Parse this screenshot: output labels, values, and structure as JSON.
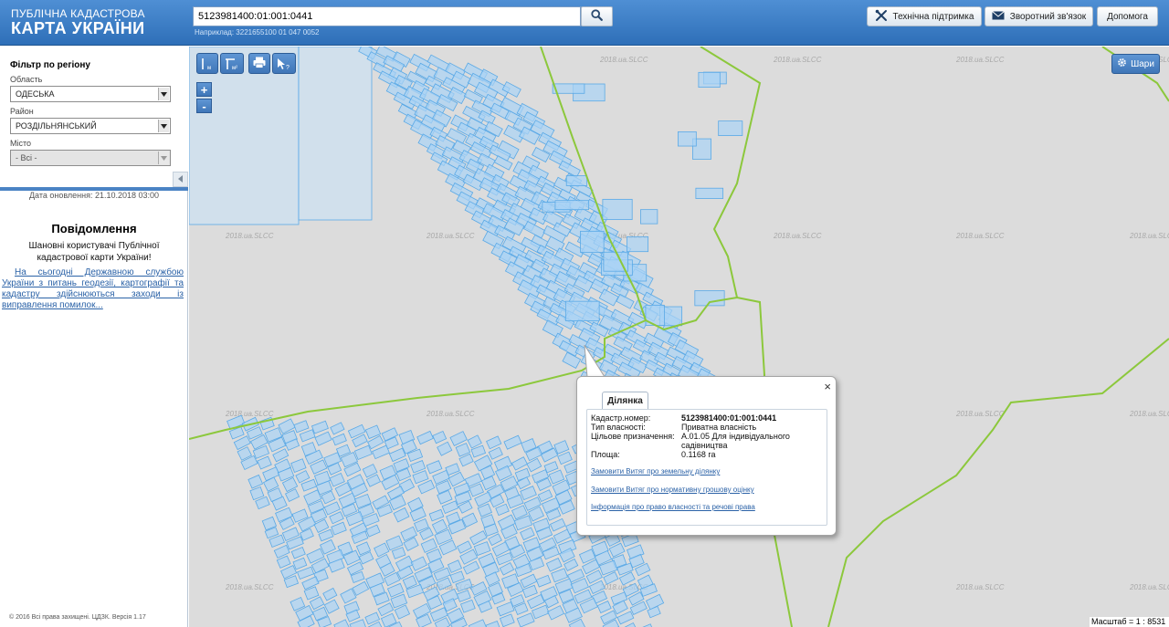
{
  "header": {
    "logo_line1": "ПУБЛІЧНА КАДАСТРОВА",
    "logo_line2": "КАРТА УКРАЇНИ",
    "search_value": "5123981400:01:001:0441",
    "search_example": "Наприклад: 3221655100 01 047 0052",
    "support_label": "Технічна підтримка",
    "feedback_label": "Зворотний зв'язок",
    "help_label": "Допомога"
  },
  "sidebar": {
    "filter_title": "Фільтр по регіону",
    "region_label": "Область",
    "region_value": "ОДЕСЬКА",
    "district_label": "Район",
    "district_value": "РОЗДІЛЬНЯНСЬКИЙ",
    "city_label": "Місто",
    "city_value": "- Всі -",
    "update_date": "Дата оновлення: 21.10.2018 03:00",
    "news_title": "Повідомлення",
    "news_text": "Шановні користувачі Публічної кадастрової карти України!",
    "news_link": "На сьогодні Державною службою України з питань геодезії, картографії та кадастру здійснюються заходи із виправлення помилок...",
    "copyright": "© 2016 Всі права захищені. ЦДЗК. Версія 1.17"
  },
  "map": {
    "watermark": "2018.ua.SLCC",
    "layers_label": "Шари",
    "zoom_in": "+",
    "zoom_out": "-",
    "tool_m": "м",
    "tool_m2": "м²",
    "tool_query": "?",
    "scale_text": "Масштаб = 1 : 8531"
  },
  "popup": {
    "tab_label": "Ділянка",
    "close_symbol": "×",
    "rows": [
      {
        "key": "Кадастр.номер:",
        "value": "5123981400:01:001:0441"
      },
      {
        "key": "Тип власності:",
        "value": "Приватна власність"
      },
      {
        "key": "Цільове призначення:",
        "value": "А.01.05 Для індивідуального садівництва"
      },
      {
        "key": "Площа:",
        "value": "0.1168 га"
      }
    ],
    "link1": "Замовити Витяг про земельну ділянку",
    "link2": "Замовити Витяг про нормативну грошову оцінку",
    "link3": "Інформація про право власності та речові права"
  },
  "colors": {
    "header_blue": "#3a7cc6",
    "parcel_fill": "#a9d3f5",
    "parcel_stroke": "#5aa9e6",
    "boundary_green": "#8cc83c",
    "map_bg": "#dcdcdc",
    "link_blue": "#2b62a7"
  },
  "icons": [
    "search-icon",
    "wrench-icon",
    "envelope-icon",
    "print-icon",
    "pointer-icon",
    "gear-icon",
    "chevron-left-icon",
    "chevron-down-icon"
  ]
}
